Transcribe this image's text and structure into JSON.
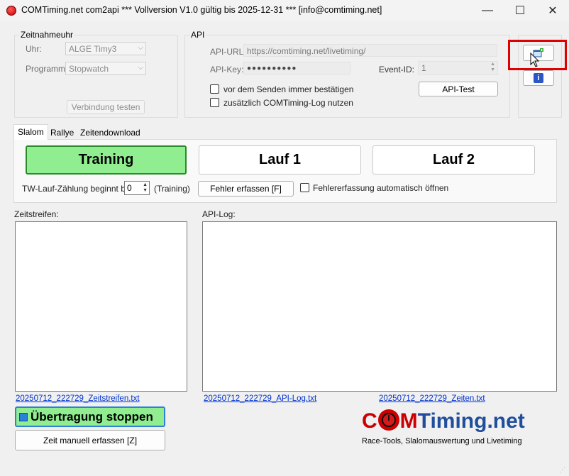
{
  "window": {
    "title": "COMTiming.net com2api *** Vollversion V1.0 gültig bis 2025-12-31 *** [info@comtiming.net]",
    "minimize": "—",
    "maximize": "☐",
    "close": "✕"
  },
  "zeitnahmeuhr": {
    "group_label": "Zeitnahmeuhr",
    "uhr_label": "Uhr:",
    "uhr_value": "ALGE Timy3",
    "programm_label": "Programm:",
    "programm_value": "Stopwatch",
    "verbindung_button": "Verbindung testen"
  },
  "api": {
    "group_label": "API",
    "url_label": "API-URL:",
    "url_value": "https://comtiming.net/livetiming/",
    "key_label": "API-Key:",
    "key_value": "●●●●●●●●●●",
    "event_label": "Event-ID:",
    "event_value": "1",
    "confirm_label": "vor dem Senden immer bestätigen",
    "log_label": "zusätzlich COMTiming-Log nutzen",
    "test_button": "API-Test"
  },
  "tabs": [
    "Slalom",
    "Rallye",
    "Zeitendownload"
  ],
  "slalom": {
    "training": "Training",
    "lauf1": "Lauf 1",
    "lauf2": "Lauf 2",
    "tw_label": "TW-Lauf-Zählung beginnt bei:",
    "tw_value": "0",
    "tw_suffix": "(Training)",
    "fehler_button": "Fehler erfassen [F]",
    "fehler_auto_label": "Fehlererfassung automatisch öffnen"
  },
  "zeitstreifen": {
    "label": "Zeitstreifen:",
    "file_link": "20250712_222729_Zeitstreifen.txt"
  },
  "apilog": {
    "label": "API-Log:",
    "file_link": "20250712_222729_API-Log.txt"
  },
  "zeiten_link": "20250712_222729_Zeiten.txt",
  "buttons": {
    "stop": "Übertragung stoppen",
    "manual": "Zeit manuell erfassen [Z]"
  },
  "logo": {
    "text_com": "C",
    "text_m": "MTiming.net",
    "tagline": "Race-Tools, Slalomauswertung und Livetiming"
  },
  "icons": {
    "side_top": "add-window-icon",
    "side_bottom": "info-icon",
    "cursor": "mouse-cursor-icon"
  },
  "colors": {
    "training_bg": "#90ee90",
    "highlight": "#e00000",
    "logo_red": "#cc0000",
    "logo_blue": "#1f4e9c"
  }
}
